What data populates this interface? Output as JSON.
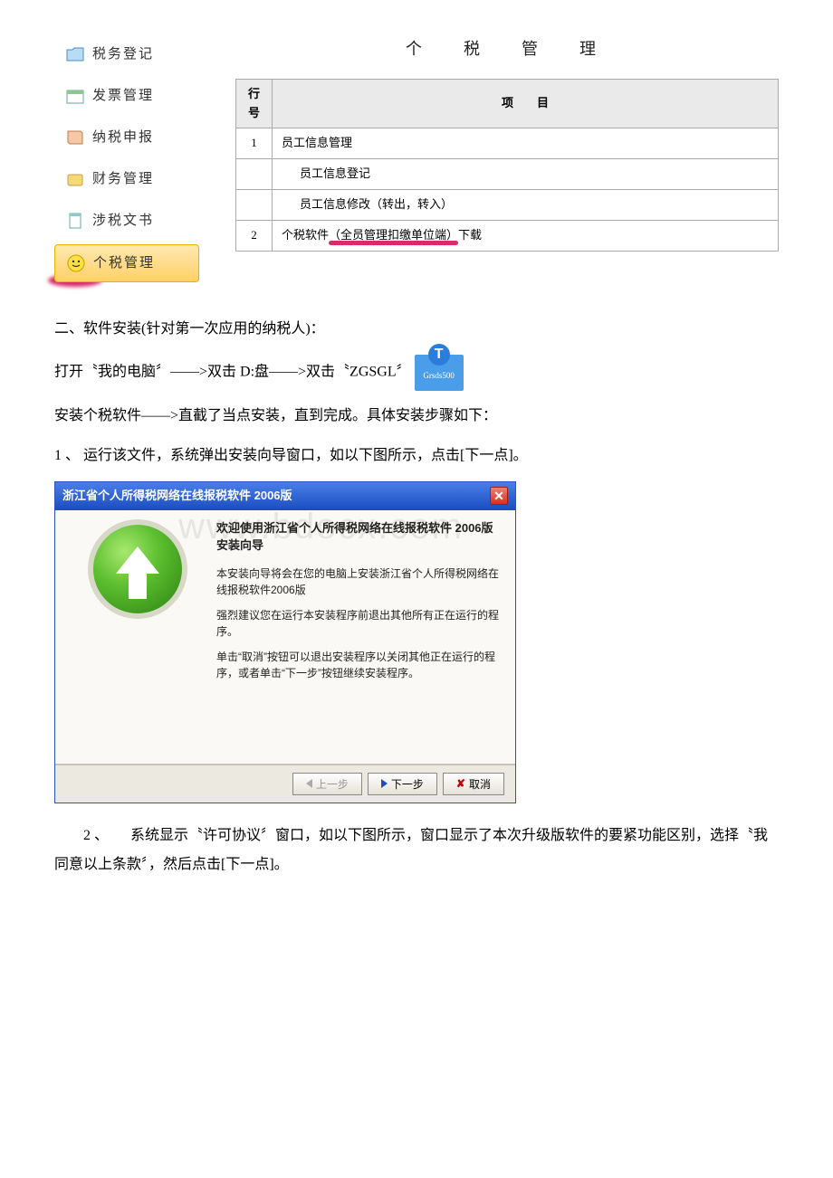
{
  "sidebar": {
    "items": [
      {
        "label": "税务登记",
        "icon": "folder"
      },
      {
        "label": "发票管理",
        "icon": "calendar"
      },
      {
        "label": "纳税申报",
        "icon": "book"
      },
      {
        "label": "财务管理",
        "icon": "wallet"
      },
      {
        "label": "涉税文书",
        "icon": "document"
      },
      {
        "label": "个税管理",
        "icon": "smile",
        "highlighted": true
      }
    ]
  },
  "section_title": "个　税　管　理",
  "table": {
    "headers": {
      "rownum": "行号",
      "item": "项　　目"
    },
    "rows": [
      {
        "num": "1",
        "text": "员工信息管理",
        "indent": 0
      },
      {
        "num": "",
        "text": "员工信息登记",
        "indent": 1
      },
      {
        "num": "",
        "text": "员工信息修改（转出，转入）",
        "indent": 1
      },
      {
        "num": "2",
        "text_prefix": "个税软件",
        "text_marked": "（全员管理扣缴单位端）",
        "text_suffix": "下载",
        "indent": 0,
        "underlined": true
      }
    ]
  },
  "para_install_heading": "二、软件安装(针对第一次应用的纳税人)：",
  "para_open": "打开〝我的电脑〞——>双击 D:盘——>双击〝ZGSGL〞",
  "desktop_icon": {
    "top": "T",
    "label": "Grsds500"
  },
  "para_install_line2": "安装个税软件——>直截了当点安装，直到完成。具体安装步骤如下：",
  "step1": "1 、 运行该文件，系统弹出安装向导窗口，如以下图所示，点击[下一点]。",
  "wizard": {
    "titlebar": "浙江省个人所得税网络在线报税软件 2006版",
    "welcome_title": "欢迎使用浙江省个人所得税网络在线报税软件 2006版 安装向导",
    "line1": "本安装向导将会在您的电脑上安装浙江省个人所得税网络在线报税软件2006版",
    "line2": "强烈建议您在运行本安装程序前退出其他所有正在运行的程序。",
    "line3": "单击“取消”按钮可以退出安装程序以关闭其他正在运行的程序，或者单击“下一步”按钮继续安装程序。",
    "buttons": {
      "prev": "上一步",
      "next": "下一步",
      "cancel": "取消"
    }
  },
  "step2": "2 、　　系统显示〝许可协议〞窗口，如以下图所示，窗口显示了本次升级版软件的要紧功能区别，选择〝我同意以上条款〞，然后点击[下一点]。",
  "watermark": "www.bdocx.com"
}
